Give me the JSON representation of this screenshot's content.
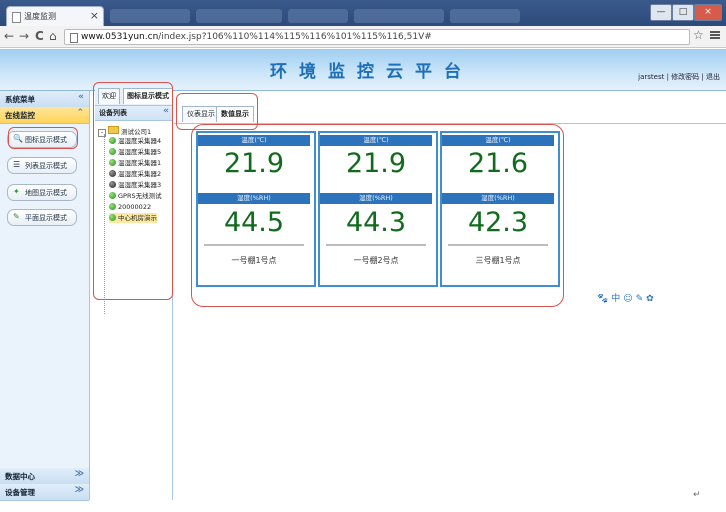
{
  "browser": {
    "tab_title": "温度监测",
    "tab_close": "×",
    "url_host": "www.0531yun.cn",
    "url_path": "/index.jsp?106%110%114%115%116%101%115%116,51V#",
    "back": "←",
    "forward": "→",
    "reload": "C",
    "home": "⌂",
    "star": "☆",
    "window_buttons": [
      "—",
      "□",
      "×"
    ]
  },
  "header": {
    "title": "环境监控云平台",
    "user": "jarstest",
    "links": [
      "修改密码",
      "退出"
    ],
    "separator": "|"
  },
  "sidebar": {
    "menu_title": "系统菜单",
    "chev_collapse": "«",
    "online_title": "在线监控",
    "online_chev": "⌃",
    "buttons": [
      {
        "icon": "🔍",
        "label": "图标显示模式"
      },
      {
        "icon": "☰",
        "label": "列表显示模式"
      },
      {
        "icon": "✦",
        "label": "地图显示模式"
      },
      {
        "icon": "✎",
        "label": "平面显示模式"
      }
    ],
    "bottom_sections": [
      {
        "title": "数据中心",
        "chev": "≫"
      },
      {
        "title": "设备管理",
        "chev": "≫"
      }
    ]
  },
  "device_panel": {
    "tabs": [
      "欢迎",
      "图标显示模式"
    ],
    "title": "设备列表",
    "chev": "«",
    "root": "测试公司1",
    "root_toggle": "-",
    "items": [
      {
        "label": "温湿度采集器4",
        "status": "green"
      },
      {
        "label": "温湿度采集器5",
        "status": "green"
      },
      {
        "label": "温湿度采集器1",
        "status": "green"
      },
      {
        "label": "温湿度采集器2",
        "status": "dark"
      },
      {
        "label": "温湿度采集器3",
        "status": "dark"
      },
      {
        "label": "GPRS无线测试",
        "status": "green"
      },
      {
        "label": "20000022",
        "status": "green"
      },
      {
        "label": "中心机房演示",
        "status": "green"
      }
    ]
  },
  "main": {
    "tabs": [
      "仪表显示",
      "数值显示"
    ],
    "cards": [
      {
        "temp_label": "温度(℃)",
        "temp": "21.9",
        "hum_label": "湿度(%RH)",
        "hum": "44.5",
        "name": "一号棚1号点"
      },
      {
        "temp_label": "温度(℃)",
        "temp": "21.9",
        "hum_label": "湿度(%RH)",
        "hum": "44.3",
        "name": "一号棚2号点"
      },
      {
        "temp_label": "温度(℃)",
        "temp": "21.6",
        "hum_label": "湿度(%RH)",
        "hum": "42.3",
        "name": "三号棚1号点"
      }
    ],
    "tool_icons": [
      "🐾",
      "中",
      "☺",
      "✎",
      "✿"
    ]
  },
  "footer_glyph": "↵"
}
